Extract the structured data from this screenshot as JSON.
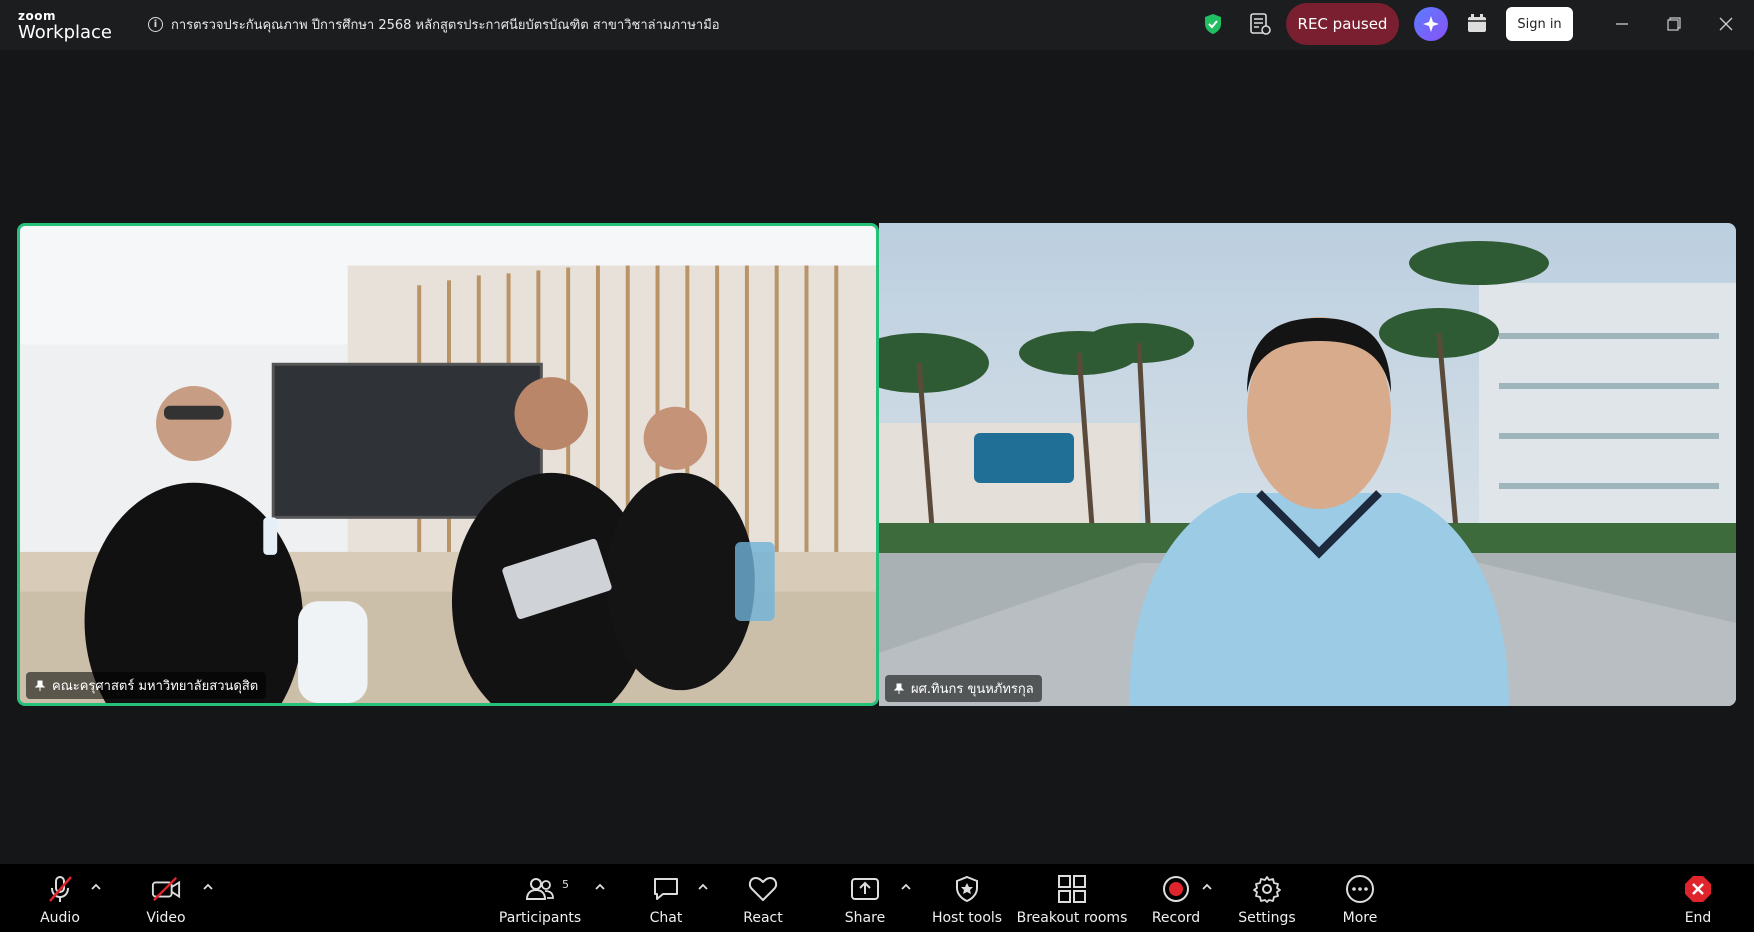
{
  "titlebar": {
    "brand_top": "zoom",
    "brand_bottom": "Workplace",
    "meeting_title": "การตรวจประกันคุณภาพ ปีการศึกษา 2568 หลักสูตรประกาศนียบัตรบัณฑิต สาขาวิชาล่ามภาษามือ",
    "rec_status": "REC paused",
    "sign_in": "Sign in"
  },
  "participants_video": [
    {
      "name": "คณะครุศาสตร์ มหาวิทยาลัยสวนดุสิต",
      "active_speaker": true
    },
    {
      "name": "ผศ.ทินกร ขุนหภัทรกุล",
      "active_speaker": false
    }
  ],
  "toolbar": {
    "audio": "Audio",
    "video": "Video",
    "participants": "Participants",
    "participants_count": "5",
    "chat": "Chat",
    "react": "React",
    "share": "Share",
    "host_tools": "Host tools",
    "breakout_rooms": "Breakout rooms",
    "record": "Record",
    "settings": "Settings",
    "more": "More",
    "end": "End"
  },
  "colors": {
    "active_speaker_border": "#26c07a",
    "rec_pill": "#7a1f30",
    "record_dot": "#e0242c",
    "muted_red": "#e0242c",
    "end_red": "#e0242c"
  }
}
